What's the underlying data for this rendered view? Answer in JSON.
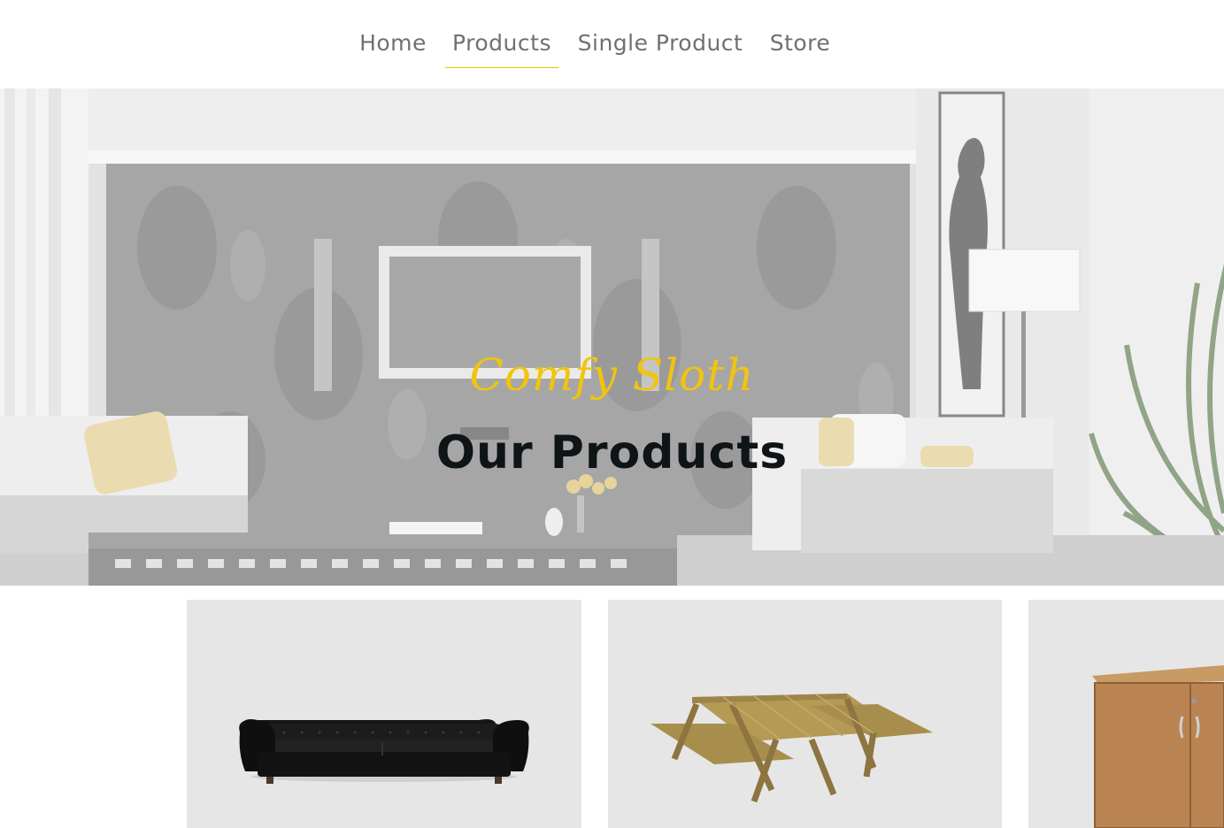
{
  "nav": {
    "items": [
      {
        "label": "Home",
        "active": false
      },
      {
        "label": "Products",
        "active": true
      },
      {
        "label": "Single Product",
        "active": false
      },
      {
        "label": "Store",
        "active": false
      }
    ],
    "active_underline_color": "#f2c200"
  },
  "hero": {
    "subtitle": "Comfy Sloth",
    "title": "Our Products",
    "subtitle_color": "#f1c40f",
    "title_color": "#0f1417",
    "background_image": "grayscale-living-room-photo"
  },
  "products": [
    {
      "image": "black-leather-chesterfield-sofa"
    },
    {
      "image": "wooden-picnic-table"
    },
    {
      "image": "wooden-cabinet"
    }
  ],
  "colors": {
    "card_background": "#e6e6e6",
    "nav_text": "#6f7072"
  }
}
